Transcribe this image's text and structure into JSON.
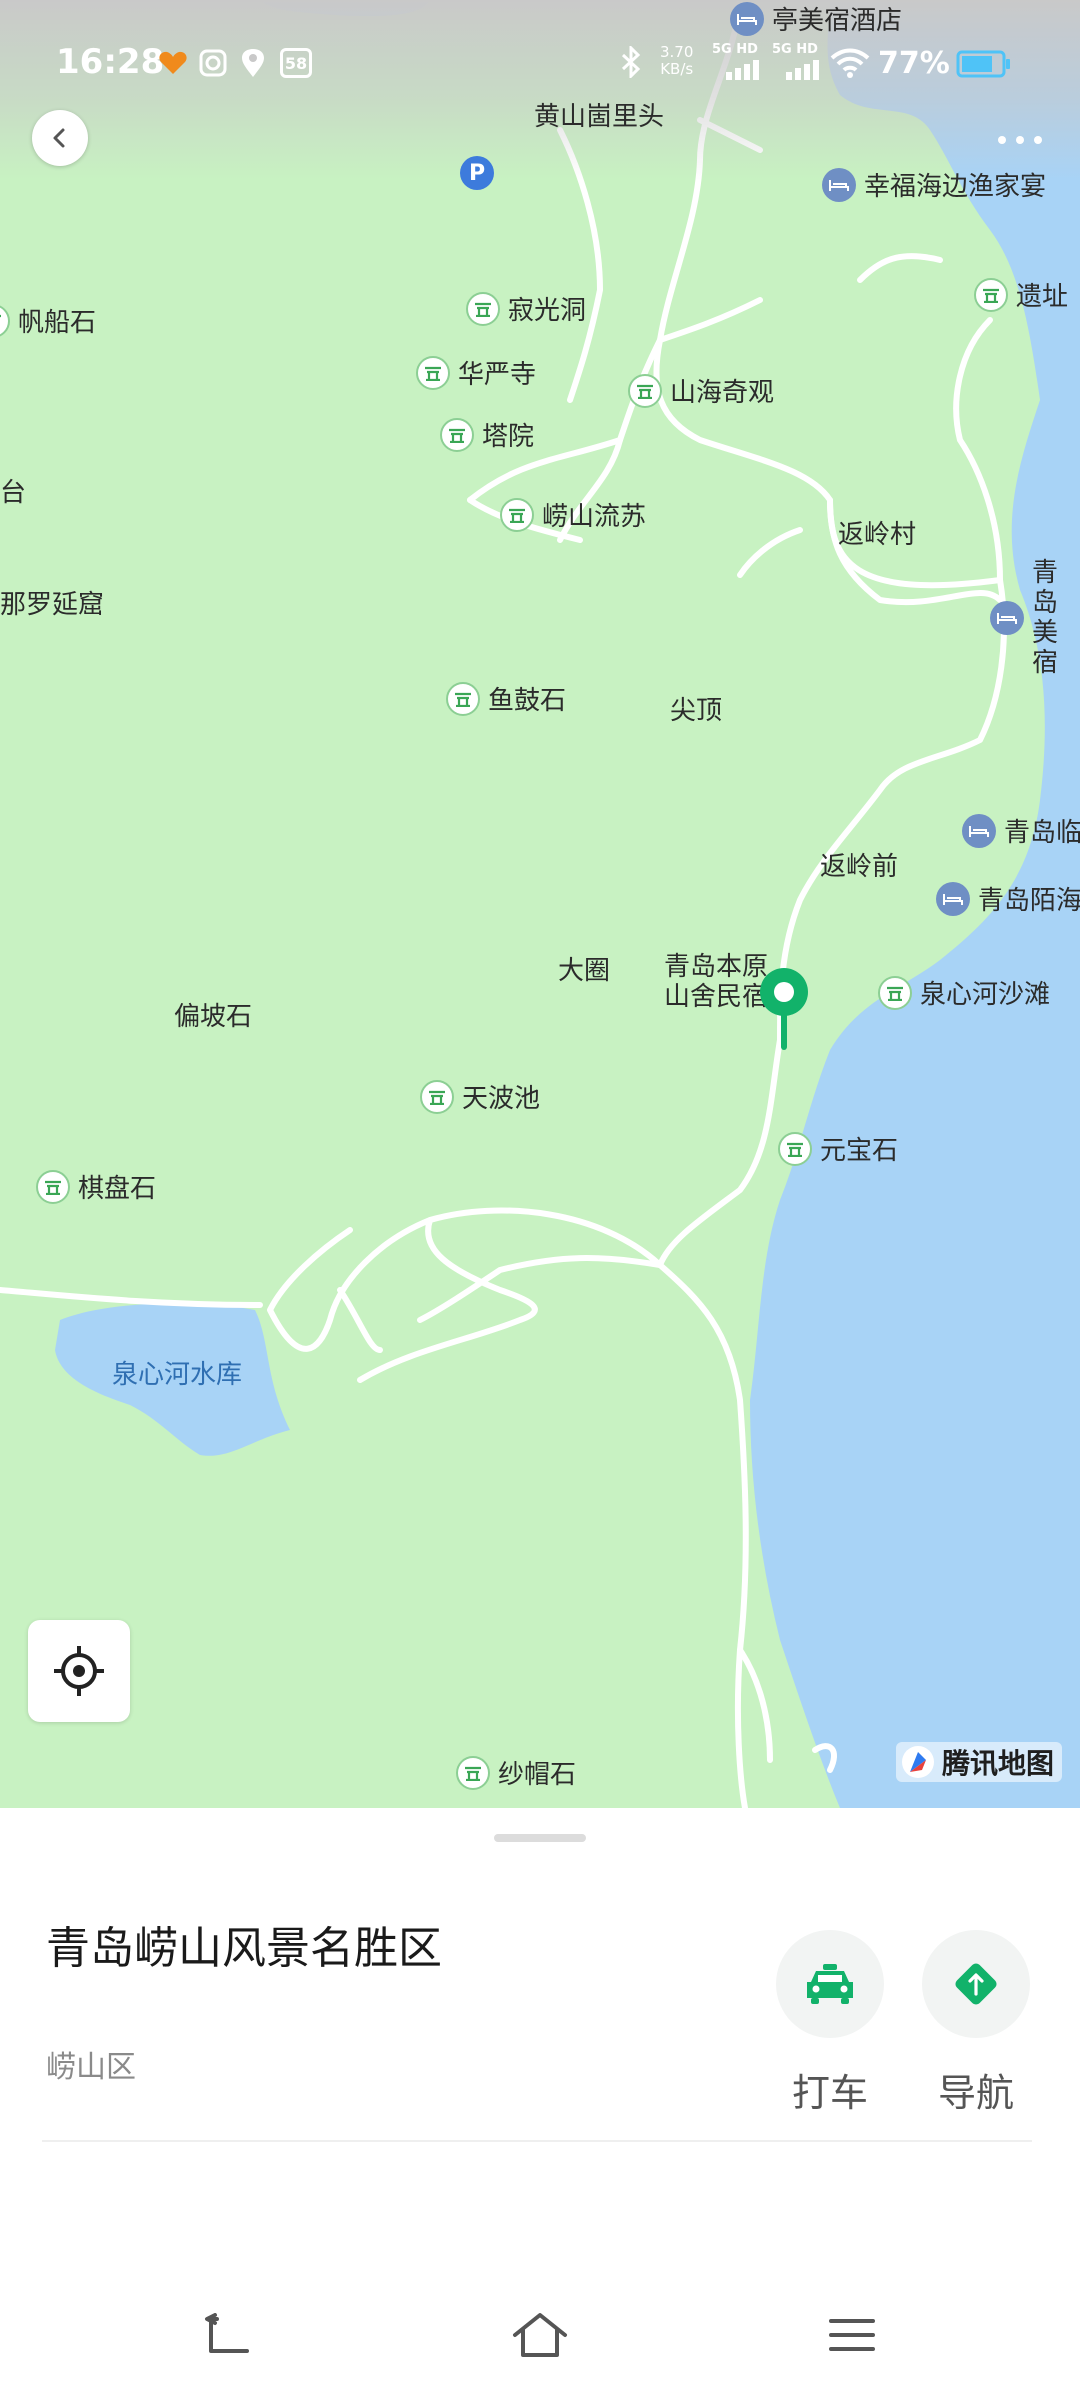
{
  "status_bar": {
    "time": "16:28",
    "net_speed_value": "3.70",
    "net_speed_unit": "KB/s",
    "sim1": "5G HD",
    "sim2": "5G HD",
    "battery": "77%",
    "icons": [
      "heart-icon",
      "camera-icon",
      "location-icon",
      "app-58-icon",
      "bluetooth-icon",
      "signal-icon",
      "wifi-icon",
      "battery-icon"
    ]
  },
  "map": {
    "pois": [
      {
        "name": "亭美宿酒店",
        "kind": "hotel"
      },
      {
        "name": "幸福海边渔家宴",
        "kind": "hotel"
      },
      {
        "name": "遗址",
        "kind": "scenic"
      },
      {
        "name": "帆船石",
        "kind": "scenic"
      },
      {
        "name": "寂光洞",
        "kind": "scenic"
      },
      {
        "name": "华严寺",
        "kind": "scenic"
      },
      {
        "name": "山海奇观",
        "kind": "scenic"
      },
      {
        "name": "塔院",
        "kind": "scenic"
      },
      {
        "name": "崂山流苏",
        "kind": "scenic"
      },
      {
        "name": "青岛美宿",
        "kind": "hotel"
      },
      {
        "name": "鱼鼓石",
        "kind": "scenic"
      },
      {
        "name": "青岛临",
        "kind": "hotel"
      },
      {
        "name": "青岛陌海",
        "kind": "hotel"
      },
      {
        "name": "泉心河沙滩",
        "kind": "scenic"
      },
      {
        "name": "天波池",
        "kind": "scenic"
      },
      {
        "name": "元宝石",
        "kind": "scenic"
      },
      {
        "name": "棋盘石",
        "kind": "scenic"
      },
      {
        "name": "纱帽石",
        "kind": "scenic"
      }
    ],
    "places": [
      "黄山崮里头",
      "返岭村",
      "那罗延窟",
      "尖顶",
      "返岭前",
      "大圈",
      "偏坡石",
      "青岛本原",
      "山舍民宿",
      "台"
    ],
    "water": "泉心河水库",
    "brand": "腾讯地图",
    "colors": {
      "land": "#c8f2c2",
      "water": "#a8d3f6",
      "road": "#ffffff",
      "accent": "#12b26a"
    }
  },
  "place": {
    "title": "青岛崂山风景名胜区",
    "district": "崂山区"
  },
  "actions": {
    "taxi_label": "打车",
    "navigate_label": "导航"
  }
}
